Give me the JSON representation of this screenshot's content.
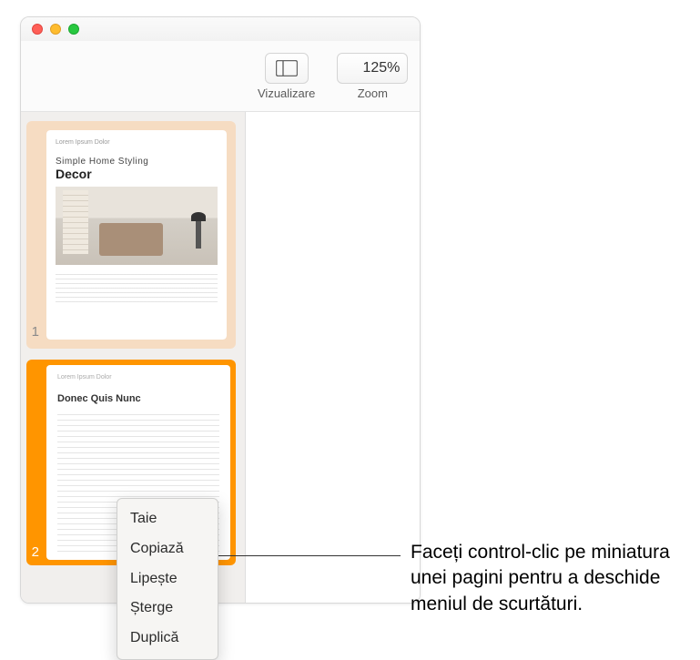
{
  "toolbar": {
    "view_label": "Vizualizare",
    "zoom_label": "Zoom",
    "zoom_value": "125%"
  },
  "sidebar": {
    "pages": [
      {
        "num": "1",
        "preheader": "Lorem Ipsum Dolor",
        "heading1": "Simple Home Styling",
        "heading2": "Decor"
      },
      {
        "num": "2",
        "preheader": "Lorem Ipsum Dolor",
        "heading": "Donec Quis Nunc"
      }
    ]
  },
  "context_menu": {
    "items": [
      {
        "label": "Taie"
      },
      {
        "label": "Copiază"
      },
      {
        "label": "Lipește"
      },
      {
        "label": "Șterge"
      },
      {
        "label": "Duplică"
      }
    ]
  },
  "callout": "Faceți control-clic pe miniatura unei pagini pentru a deschide meniul de scurtături."
}
